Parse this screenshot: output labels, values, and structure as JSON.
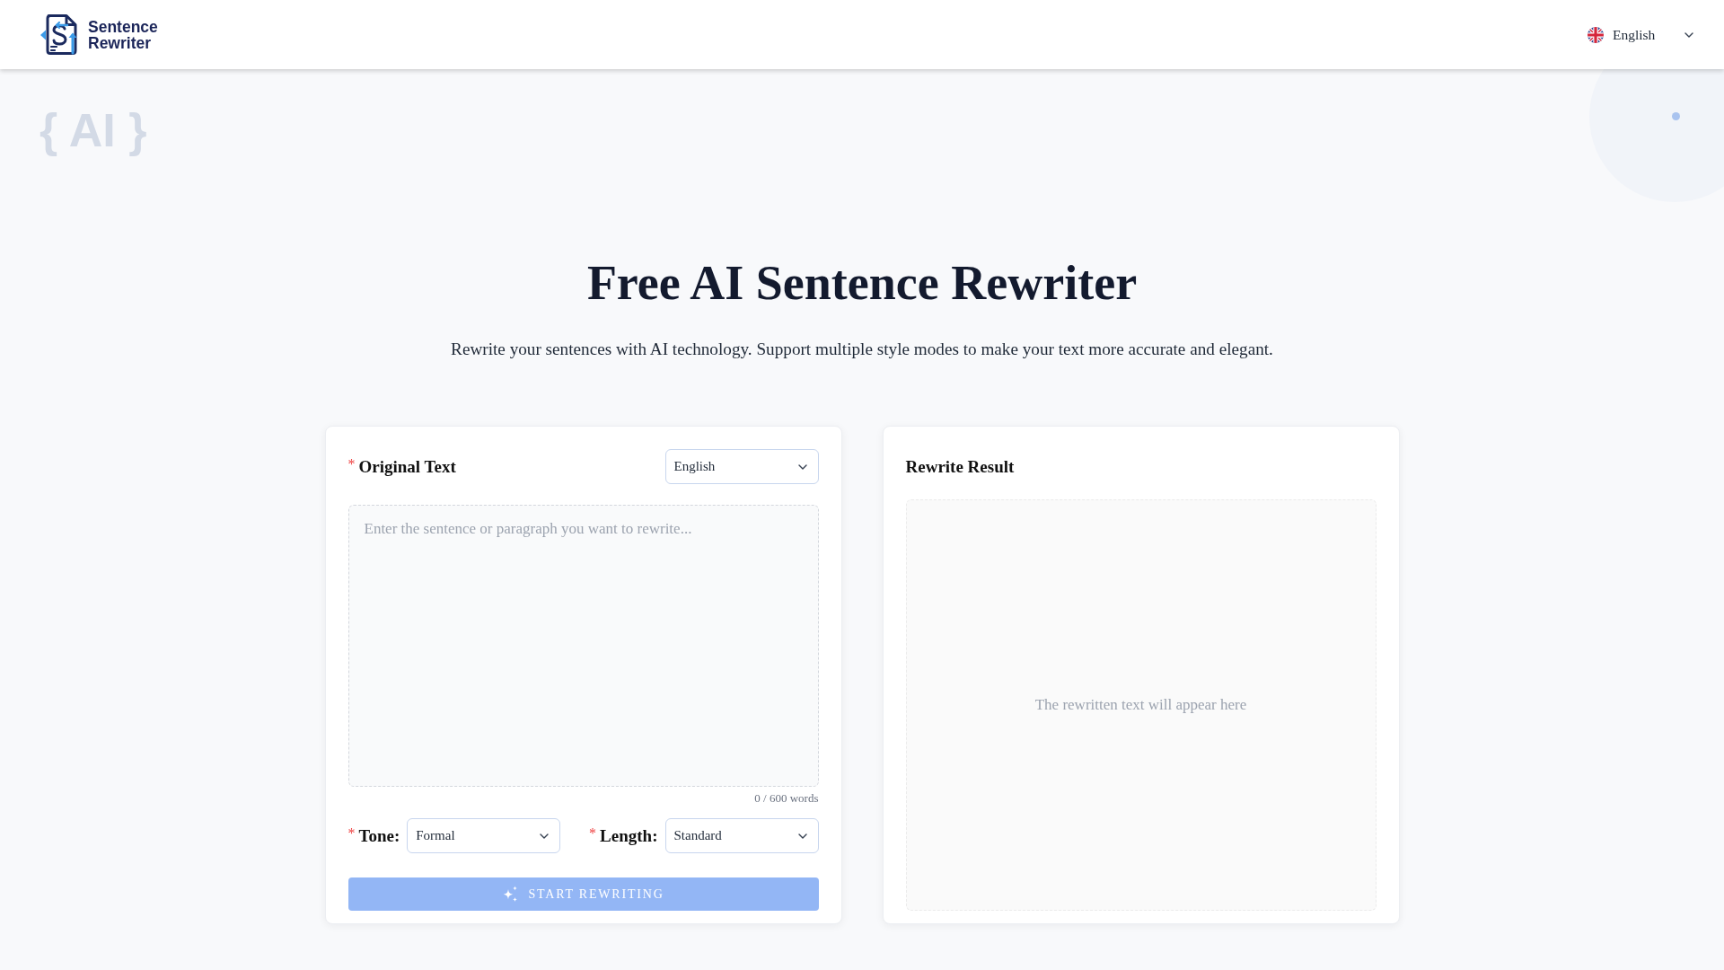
{
  "header": {
    "logo": {
      "lines": [
        "Sentence",
        "Rewriter"
      ]
    },
    "language_menu": {
      "label": "English"
    }
  },
  "decoration": {
    "text": "{ AI }"
  },
  "hero": {
    "title": "Free AI Sentence Rewriter",
    "subtitle": "Rewrite your sentences with AI technology. Support multiple style modes to make your text more accurate and elegant."
  },
  "original_panel": {
    "required_mark": "*",
    "title": "Original Text",
    "language_select": {
      "value": "English"
    },
    "text_input": {
      "placeholder": "Enter the sentence or paragraph you want to rewrite..."
    },
    "word_count": "0 / 600 words",
    "options": [
      {
        "required_mark": "*",
        "label": "Tone:",
        "value": "Formal"
      },
      {
        "required_mark": "*",
        "label": "Length:",
        "value": "Standard"
      }
    ],
    "submit_button": {
      "label": "START REWRITING",
      "disabled": true
    }
  },
  "result_panel": {
    "title": "Rewrite Result",
    "placeholder": "The rewritten text will appear here"
  }
}
